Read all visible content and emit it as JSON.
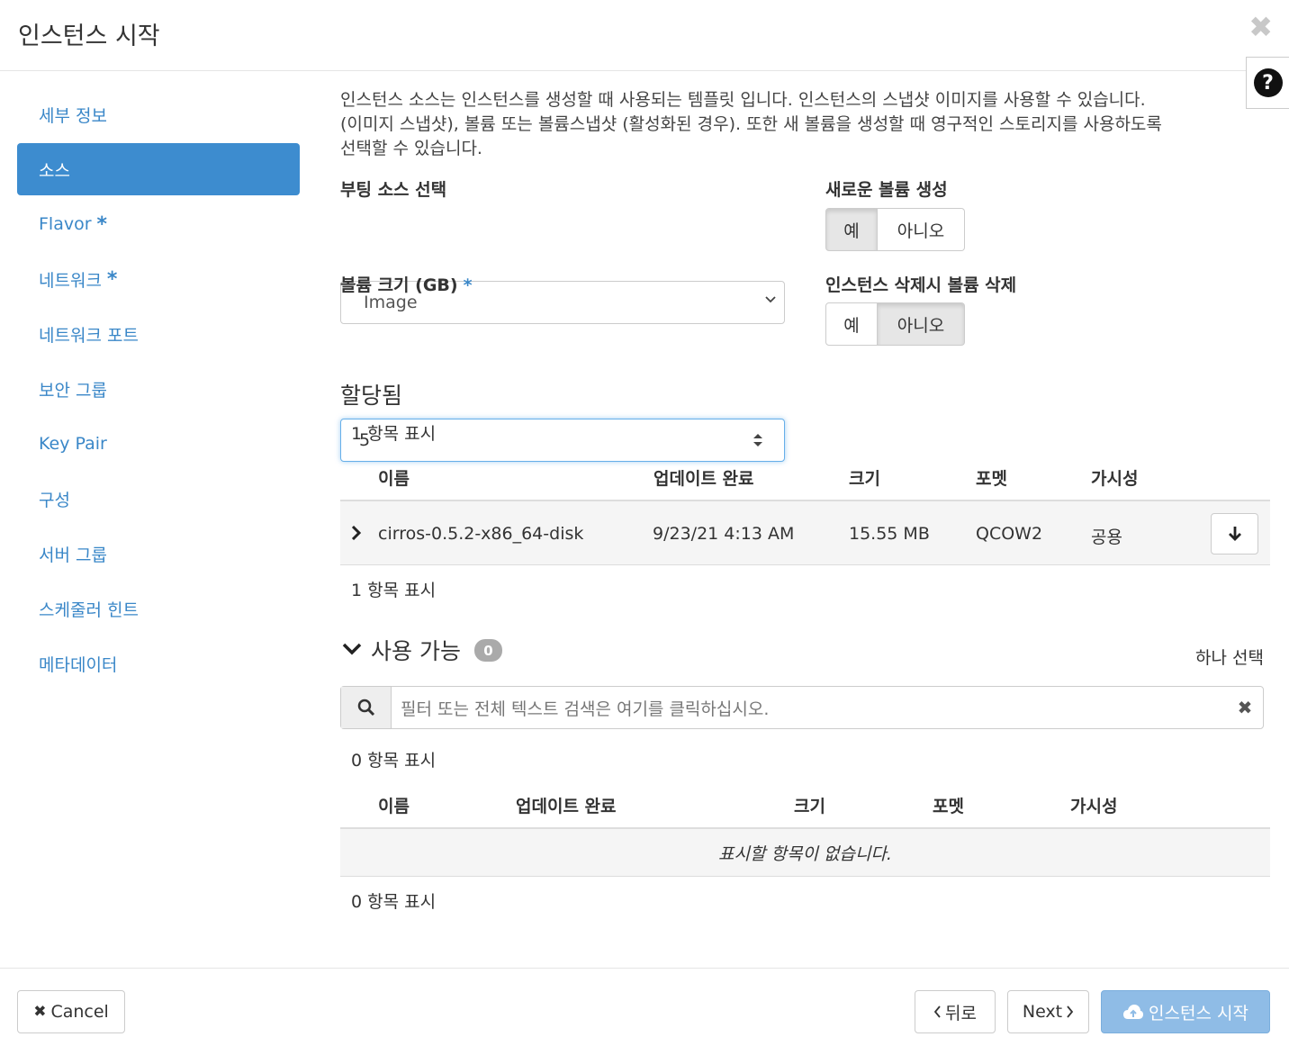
{
  "dialog": {
    "title": "인스턴스 시작",
    "close_symbol": "✖",
    "help_symbol": "?"
  },
  "sidebar": {
    "items": [
      {
        "label": "세부 정보",
        "required": false
      },
      {
        "label": "소스",
        "required": false,
        "active": true
      },
      {
        "label": "Flavor",
        "required": true
      },
      {
        "label": "네트워크",
        "required": true
      },
      {
        "label": "네트워크 포트",
        "required": false
      },
      {
        "label": "보안 그룹",
        "required": false
      },
      {
        "label": "Key Pair",
        "required": false
      },
      {
        "label": "구성",
        "required": false
      },
      {
        "label": "서버 그룹",
        "required": false
      },
      {
        "label": "스케줄러 힌트",
        "required": false
      },
      {
        "label": "메타데이터",
        "required": false
      }
    ],
    "required_marker": "*"
  },
  "source": {
    "description_1": "인스턴스 소스는 인스턴스를 생성할 때 사용되는 템플릿 입니다. 인스턴스의 스냅샷 이미지를 사용할 수 있습니다.",
    "description_2": "(이미지 스냅샷), 볼륨 또는 볼륨스냅샷 (활성화된 경우). 또한 새 볼륨을 생성할 때 영구적인 스토리지를 사용하도록",
    "description_3": "선택할 수 있습니다.",
    "boot_source_label": "부팅 소스 선택",
    "boot_source_value": "Image",
    "new_volume_label": "새로운 볼륨 생성",
    "new_volume_yes": "예",
    "new_volume_no": "아니오",
    "new_volume_selected": "예",
    "volume_size_label": "볼륨 크기 (GB)",
    "volume_size_value": "5",
    "delete_volume_label": "인스턴스 삭제시 볼륨 삭제",
    "delete_volume_yes": "예",
    "delete_volume_no": "아니오",
    "delete_volume_selected": "아니오"
  },
  "allocated": {
    "title": "할당됨",
    "count_top": "1 항목 표시",
    "count_bottom": "1 항목 표시",
    "columns": [
      "이름",
      "업데이트 완료",
      "크기",
      "포멧",
      "가시성"
    ],
    "rows": [
      {
        "name": "cirros-0.5.2-x86_64-disk",
        "updated": "9/23/21 4:13 AM",
        "size": "15.55 MB",
        "format": "QCOW2",
        "visibility": "공용"
      }
    ]
  },
  "available": {
    "title": "사용 가능",
    "badge": "0",
    "select_one": "하나 선택",
    "filter_placeholder": "필터 또는 전체 텍스트 검색은 여기를 클릭하십시오.",
    "count_top": "0 항목 표시",
    "count_bottom": "0 항목 표시",
    "columns": [
      "이름",
      "업데이트 완료",
      "크기",
      "포멧",
      "가시성"
    ],
    "empty_message": "표시할 항목이 없습니다."
  },
  "footer": {
    "cancel_label": "Cancel",
    "back_label": "뒤로",
    "next_label": "Next",
    "launch_label": "인스턴스 시작"
  },
  "colors": {
    "accent": "#3d8ccf",
    "link": "#3a87c8",
    "primary_disabled": "#8fbce6"
  }
}
